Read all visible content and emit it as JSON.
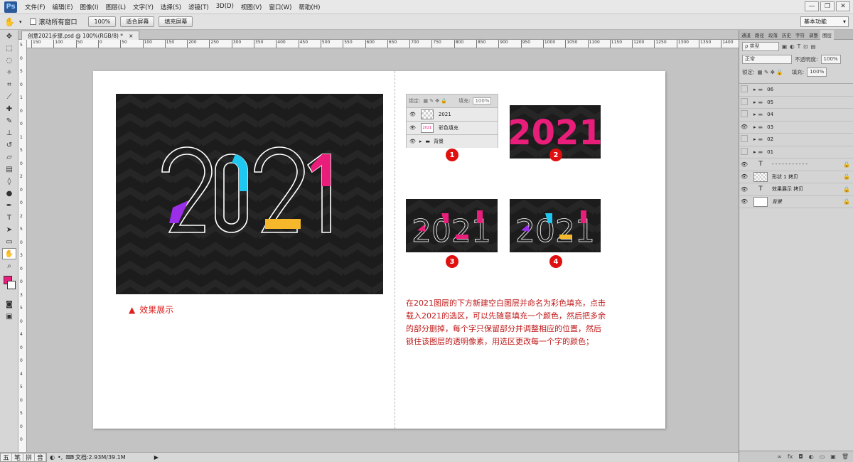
{
  "app": {
    "logo": "Ps"
  },
  "menu": [
    "文件(F)",
    "编辑(E)",
    "图像(I)",
    "图层(L)",
    "文字(Y)",
    "选择(S)",
    "滤镜(T)",
    "3D(D)",
    "视图(V)",
    "窗口(W)",
    "帮助(H)"
  ],
  "window_buttons": [
    "—",
    "❐",
    "✕"
  ],
  "options": {
    "checkbox_label": "滚动所有窗口",
    "zoom_value": "100%",
    "fit_button": "适合屏幕",
    "fill_button": "填充屏幕",
    "workspace": "基本功能"
  },
  "document": {
    "tab_title": "创意2021步骤.psd @ 100%(RGB/8) *",
    "close": "×"
  },
  "ruler_h": [
    "150",
    "100",
    "50",
    "0",
    "50",
    "100",
    "150",
    "200",
    "250",
    "300",
    "350",
    "400",
    "450",
    "500",
    "550",
    "600",
    "650",
    "700",
    "750",
    "800",
    "850",
    "900",
    "950",
    "1000",
    "1050",
    "1100",
    "1150",
    "1200",
    "1250",
    "1300",
    "1350",
    "1400"
  ],
  "ruler_v": [
    "5",
    "0",
    "5",
    "0",
    "1",
    "0",
    "0",
    "1",
    "5",
    "0",
    "2",
    "0",
    "0",
    "2",
    "5",
    "0",
    "3",
    "0",
    "0",
    "3",
    "5",
    "0",
    "4",
    "0",
    "0",
    "4",
    "5",
    "0",
    "5",
    "0",
    "0"
  ],
  "canvas": {
    "main_art_text": "2021",
    "caption": "效果展示",
    "caption_marker": "▲",
    "snippet": {
      "lock_label": "锁定:",
      "fill_label": "填充:",
      "fill_value": "100%",
      "layers": [
        {
          "name": "2021"
        },
        {
          "name": "彩色填充",
          "thumb_text": "2021"
        },
        {
          "name": "背景"
        }
      ]
    },
    "steps": [
      {
        "label": "1",
        "art_text": ""
      },
      {
        "label": "2",
        "art_text": "2021"
      },
      {
        "label": "3",
        "art_text": "2021"
      },
      {
        "label": "4",
        "art_text": "2021"
      }
    ],
    "description": [
      "在2021图层的下方新建空白图层并命名为彩色填充，点击",
      "载入2021的选区，可以先随意填充一个颜色，然后把多余",
      "的部分删掉，每个字只保留部分并调整相应的位置，然后",
      "锁住该图层的透明像素，用选区更改每一个字的颜色；"
    ]
  },
  "layers_panel": {
    "tabs": [
      "通道",
      "路径",
      "段落",
      "历史",
      "字符",
      "调整",
      "图层"
    ],
    "filter_label": "ρ 类型",
    "blend_mode": "正常",
    "opacity_label": "不透明度:",
    "opacity_value": "100%",
    "lock_label": "锁定:",
    "fill_label": "填充:",
    "fill_value": "100%",
    "layers": [
      {
        "name": "06",
        "type": "group",
        "visible": false
      },
      {
        "name": "05",
        "type": "group",
        "visible": false
      },
      {
        "name": "04",
        "type": "group",
        "visible": false
      },
      {
        "name": "03",
        "type": "group",
        "visible": true
      },
      {
        "name": "02",
        "type": "group",
        "visible": false
      },
      {
        "name": "01",
        "type": "group",
        "visible": false
      },
      {
        "name": "- - - - - - - - - - -",
        "type": "text",
        "visible": true,
        "locked": true
      },
      {
        "name": "形状 1 拷贝",
        "type": "shape",
        "visible": true,
        "locked": true
      },
      {
        "name": "效果展示 拷贝",
        "type": "text",
        "visible": true,
        "locked": true
      },
      {
        "name": "背景",
        "type": "bg",
        "visible": true,
        "locked": true
      }
    ],
    "footer_icons": [
      "∞",
      "fx",
      "◘",
      "◐",
      "▭",
      "▣",
      "🗑"
    ]
  },
  "status": {
    "ime": [
      "五",
      "笔",
      "拼",
      "音"
    ],
    "doc_info": "文档:2.93M/39.1M"
  },
  "colors": {
    "accent_pink": "#e91e7a",
    "accent_cyan": "#1ec8f0",
    "accent_purple": "#9b2ee8",
    "accent_yellow": "#f5b82a",
    "badge_red": "#e01010",
    "text_red": "#c01818",
    "foreground": "#e91e7a"
  }
}
